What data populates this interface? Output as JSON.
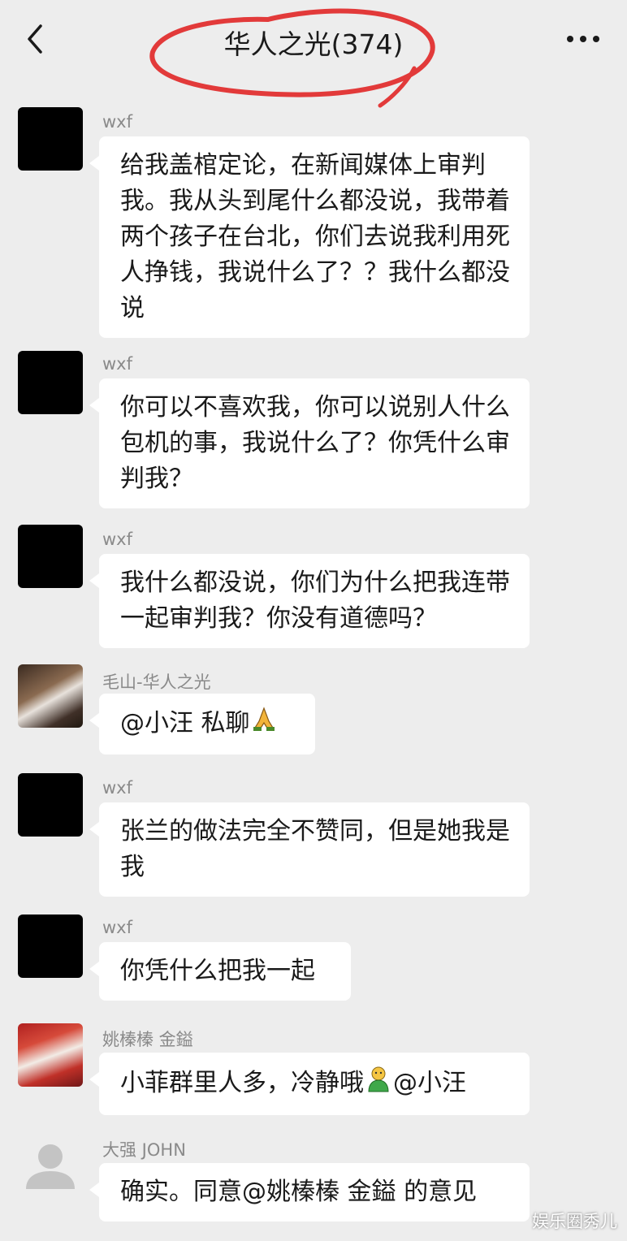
{
  "header": {
    "title": "华人之光(374)",
    "back_icon": "chevron-left-icon",
    "more_icon": "more-dots-icon",
    "annotation_color": "#e23a3a"
  },
  "messages": [
    {
      "sender": "wxf",
      "avatar": "black",
      "text": "给我盖棺定论，在新闻媒体上审判我。我从头到尾什么都没说，我带着两个孩子在台北，你们去说我利用死人挣钱，我说什么了？？我什么都没说"
    },
    {
      "sender": "wxf",
      "avatar": "black",
      "text": "你可以不喜欢我，你可以说别人什么包机的事，我说什么了？你凭什么审判我？"
    },
    {
      "sender": "wxf",
      "avatar": "black",
      "text": "我什么都没说，你们为什么把我连带一起审判我？你没有道德吗？"
    },
    {
      "sender": "毛山-华人之光",
      "avatar": "photo",
      "text": "@小汪  私聊",
      "emoji": "folded-hands-icon"
    },
    {
      "sender": "wxf",
      "avatar": "black",
      "text": "张兰的做法完全不赞同，但是她我是我"
    },
    {
      "sender": "wxf",
      "avatar": "black",
      "text": "你凭什么把我一起"
    },
    {
      "sender": "姚榛榛 金鎰",
      "avatar": "photo",
      "text_before": "小菲群里人多，冷静哦",
      "emoji": "person-emoji-icon",
      "text_after": "@小汪"
    },
    {
      "sender": "大强 JOHN",
      "avatar": "default",
      "text": "确实。同意@姚榛榛 金鎰  的意见"
    }
  ],
  "watermark": "娱乐圈秀儿"
}
